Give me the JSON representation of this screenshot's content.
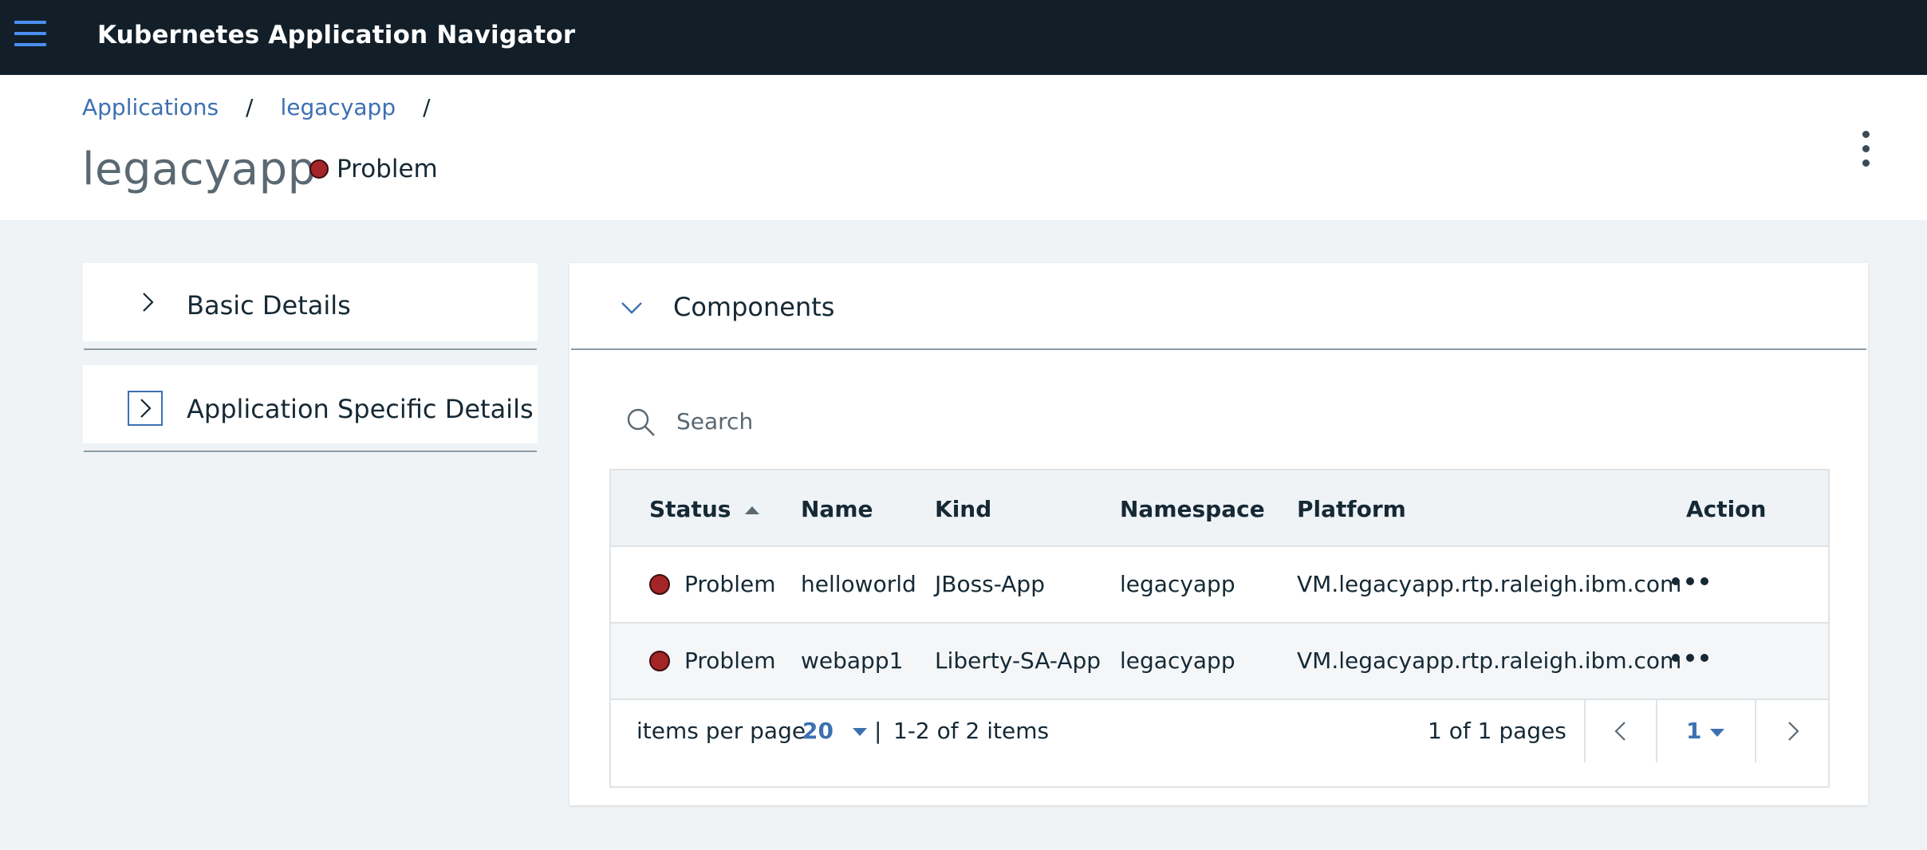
{
  "topbar": {
    "title": "Kubernetes Application Navigator",
    "menu_icon": "hamburger-menu-icon"
  },
  "breadcrumb": {
    "items": [
      "Applications",
      "legacyapp"
    ],
    "separator": "/"
  },
  "page": {
    "title": "legacyapp",
    "status": "Problem",
    "status_color": "#a42527"
  },
  "accordions": [
    {
      "label": "Basic Details",
      "expanded": false,
      "icon": "chevron-right-icon"
    },
    {
      "label": "Application Specific Details",
      "expanded": false,
      "icon": "chevron-right-icon",
      "focused": true
    }
  ],
  "components": {
    "title": "Components",
    "expanded": true,
    "search_placeholder": "Search",
    "columns": [
      "Status",
      "Name",
      "Kind",
      "Namespace",
      "Platform",
      "Action"
    ],
    "sorted_column": "Status",
    "sort_direction": "ascending",
    "rows": [
      {
        "status": "Problem",
        "name": "helloworld",
        "kind": "JBoss-App",
        "namespace": "legacyapp",
        "platform": "VM.legacyapp.rtp.raleigh.ibm.com"
      },
      {
        "status": "Problem",
        "name": "webapp1",
        "kind": "Liberty-SA-App",
        "namespace": "legacyapp",
        "platform": "VM.legacyapp.rtp.raleigh.ibm.com"
      }
    ],
    "pagination": {
      "items_per_page_label": "items per page",
      "items_per_page": "20",
      "divider": "|",
      "range": "1-2 of 2 items",
      "pages_text": "1 of 1 pages",
      "current_page": "1"
    }
  },
  "colors": {
    "topbar": "#121f29",
    "accent": "#3d70b2",
    "hamburger": "#4a8ff2",
    "problem": "#a42527",
    "background": "#eff3f6"
  }
}
